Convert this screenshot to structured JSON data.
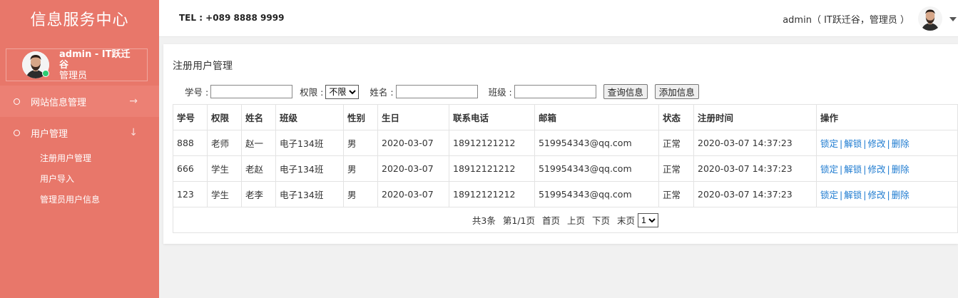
{
  "brand": "信息服务中心",
  "sidebar_user": {
    "name": "admin - IT跃迁谷",
    "role": "管理员"
  },
  "menu": [
    {
      "label": "网站信息管理",
      "arrow": "→"
    },
    {
      "label": "用户管理",
      "arrow": "↓"
    }
  ],
  "submenu": [
    "注册用户管理",
    "用户导入",
    "管理员用户信息"
  ],
  "topbar": {
    "tel": "TEL : +089 8888 9999",
    "user": "admin（ IT跃迁谷，管理员 ）"
  },
  "panel_title": "注册用户管理",
  "filter": {
    "student_id_label": "学号 :",
    "role_label": "权限 :",
    "role_value": "不限",
    "name_label": "姓名 :",
    "class_label": "班级 :",
    "search_button": "查询信息",
    "add_button": "添加信息"
  },
  "table": {
    "headers": [
      "学号",
      "权限",
      "姓名",
      "班级",
      "性别",
      "生日",
      "联系电话",
      "邮箱",
      "状态",
      "注册时间",
      "操作"
    ],
    "rows": [
      [
        "888",
        "老师",
        "赵一",
        "电子134班",
        "男",
        "2020-03-07",
        "18912121212",
        "519954343@qq.com",
        "正常",
        "2020-03-07 14:37:23"
      ],
      [
        "666",
        "学生",
        "老赵",
        "电子134班",
        "男",
        "2020-03-07",
        "18912121212",
        "519954343@qq.com",
        "正常",
        "2020-03-07 14:37:23"
      ],
      [
        "123",
        "学生",
        "老李",
        "电子134班",
        "男",
        "2020-03-07",
        "18912121212",
        "519954343@qq.com",
        "正常",
        "2020-03-07 14:37:23"
      ]
    ],
    "actions": [
      "锁定",
      "解锁",
      "修改",
      "删除"
    ],
    "action_sep": "|"
  },
  "pager": {
    "total": "共3条",
    "page_info": "第1/1页",
    "first": "首页",
    "prev": "上页",
    "next": "下页",
    "last": "末页",
    "page_value": "1"
  },
  "colors": {
    "sidebar": "#e8776a",
    "link": "#1e7bd0",
    "online": "#2ecc71"
  }
}
